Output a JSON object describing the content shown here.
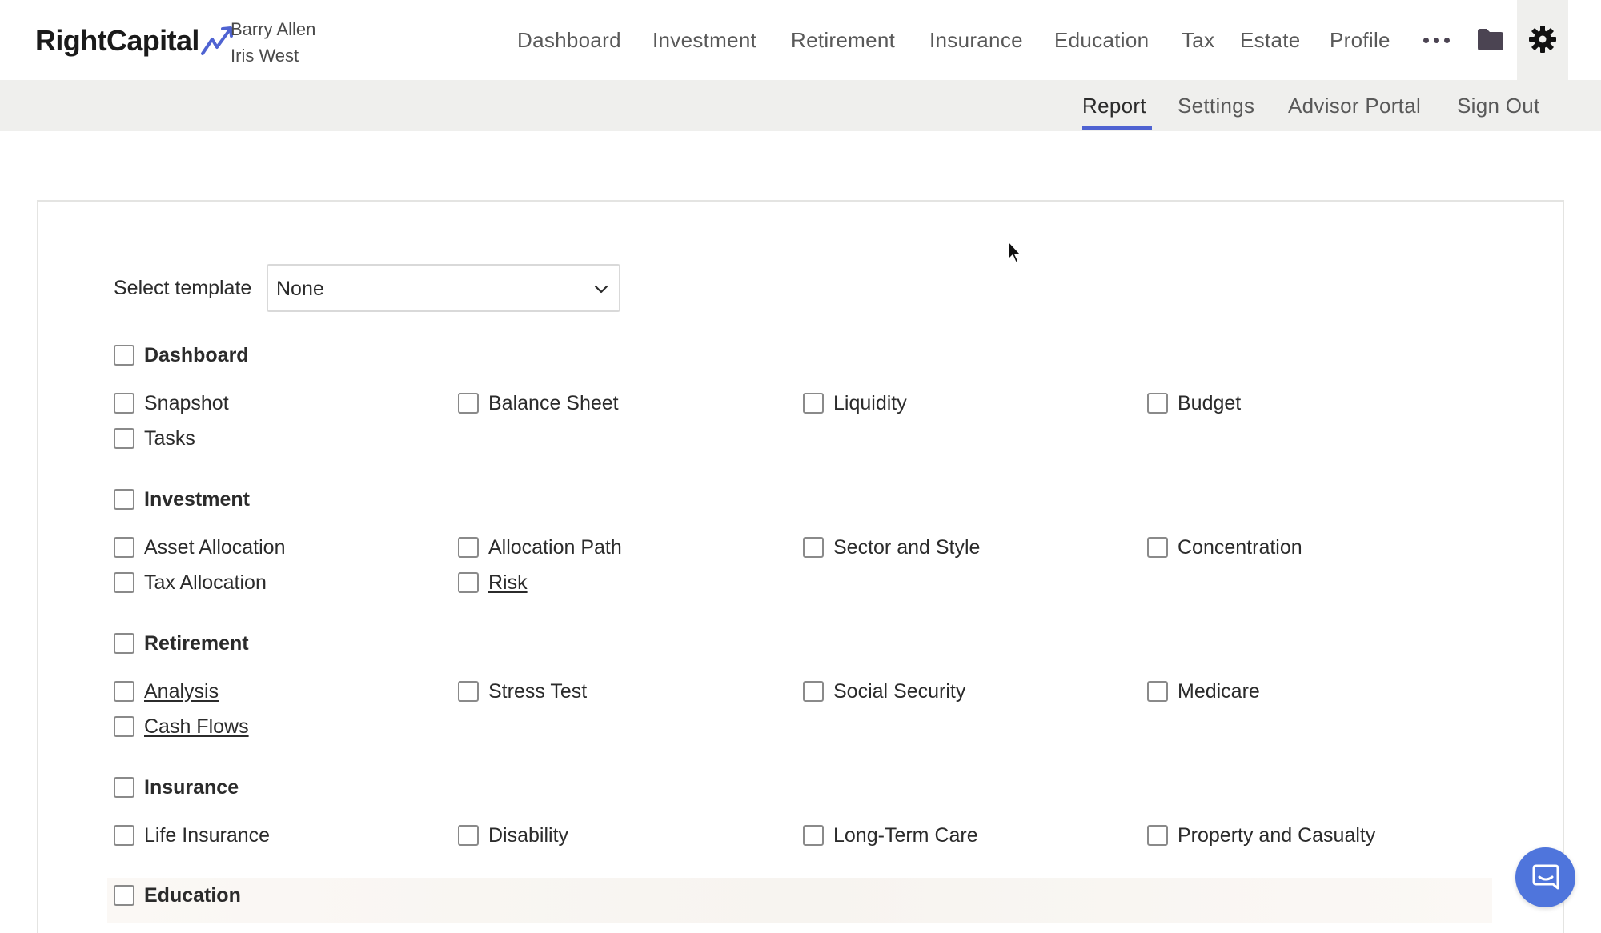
{
  "header": {
    "logo_text": "RightCapital",
    "client_primary": "Barry Allen",
    "client_secondary": "Iris West",
    "nav": [
      {
        "label": "Dashboard"
      },
      {
        "label": "Investment"
      },
      {
        "label": "Retirement"
      },
      {
        "label": "Insurance"
      },
      {
        "label": "Education"
      },
      {
        "label": "Tax"
      },
      {
        "label": "Estate"
      },
      {
        "label": "Profile"
      }
    ],
    "icons": [
      "more-icon",
      "folder-icon",
      "gear-icon"
    ]
  },
  "subnav": {
    "items": [
      {
        "label": "Report",
        "active": true
      },
      {
        "label": "Settings"
      },
      {
        "label": "Advisor Portal"
      },
      {
        "label": "Sign Out"
      }
    ],
    "accent_color": "#4f63d2"
  },
  "template": {
    "label": "Select template",
    "value": "None"
  },
  "sections": [
    {
      "title": "Dashboard",
      "items": [
        {
          "label": "Snapshot"
        },
        {
          "label": "Balance Sheet"
        },
        {
          "label": "Liquidity"
        },
        {
          "label": "Budget"
        },
        {
          "label": "Tasks"
        }
      ]
    },
    {
      "title": "Investment",
      "items": [
        {
          "label": "Asset Allocation"
        },
        {
          "label": "Allocation Path"
        },
        {
          "label": "Sector and Style"
        },
        {
          "label": "Concentration"
        },
        {
          "label": "Tax Allocation"
        },
        {
          "label": "Risk",
          "link": true
        }
      ]
    },
    {
      "title": "Retirement",
      "items": [
        {
          "label": "Analysis",
          "link": true
        },
        {
          "label": "Stress Test"
        },
        {
          "label": "Social Security"
        },
        {
          "label": "Medicare"
        },
        {
          "label": "Cash Flows",
          "link": true
        }
      ]
    },
    {
      "title": "Insurance",
      "items": [
        {
          "label": "Life Insurance"
        },
        {
          "label": "Disability"
        },
        {
          "label": "Long-Term Care"
        },
        {
          "label": "Property and Casualty"
        }
      ]
    },
    {
      "title": "Education",
      "items": []
    }
  ],
  "chat": {
    "icon": "chat-icon",
    "color": "#4f75dc"
  }
}
